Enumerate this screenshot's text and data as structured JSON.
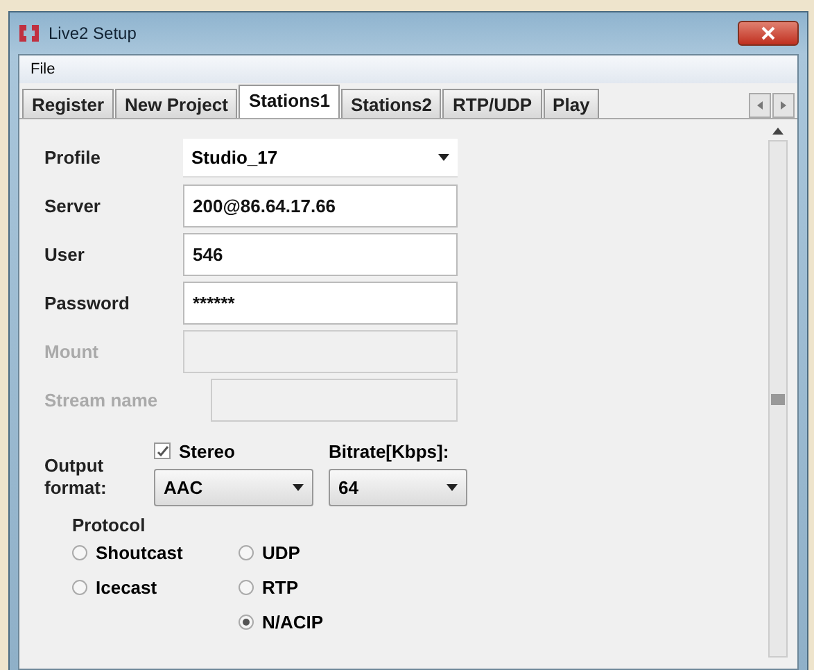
{
  "window": {
    "title": "Live2 Setup"
  },
  "menu": [
    "File"
  ],
  "tabs": [
    {
      "label": "Register",
      "selected": false
    },
    {
      "label": "New Project",
      "selected": false
    },
    {
      "label": "Stations1",
      "selected": true
    },
    {
      "label": "Stations2",
      "selected": false
    },
    {
      "label": "RTP/UDP",
      "selected": false
    },
    {
      "label": "Play",
      "selected": false
    }
  ],
  "fields": [
    {
      "label": "Profile",
      "kind": "dropdown",
      "value": "Studio_17",
      "disabled": false
    },
    {
      "label": "Server",
      "kind": "text",
      "value": "200@86.64.17.66",
      "disabled": false
    },
    {
      "label": "User",
      "kind": "text",
      "value": "546",
      "disabled": false
    },
    {
      "label": "Password",
      "kind": "text",
      "value": "******",
      "disabled": false
    },
    {
      "label": "Mount",
      "kind": "text",
      "disabled": true
    },
    {
      "label": "Stream name",
      "kind": "text",
      "disabled": true
    }
  ],
  "output": {
    "label_lines": [
      "Output",
      "format:"
    ],
    "stereo": {
      "label": "Stereo",
      "checked": true
    },
    "format": "AAC",
    "bitrate_label": "Bitrate[Kbps]:",
    "bitrate": "64"
  },
  "protocol": {
    "title": "Protocol",
    "columns": [
      [
        {
          "label": "Shoutcast",
          "selected": false
        },
        {
          "label": "Icecast",
          "selected": false
        }
      ],
      [
        {
          "label": "UDP",
          "selected": false
        },
        {
          "label": "RTP",
          "selected": false
        },
        {
          "label": "N/ACIP",
          "selected": true
        }
      ]
    ]
  }
}
